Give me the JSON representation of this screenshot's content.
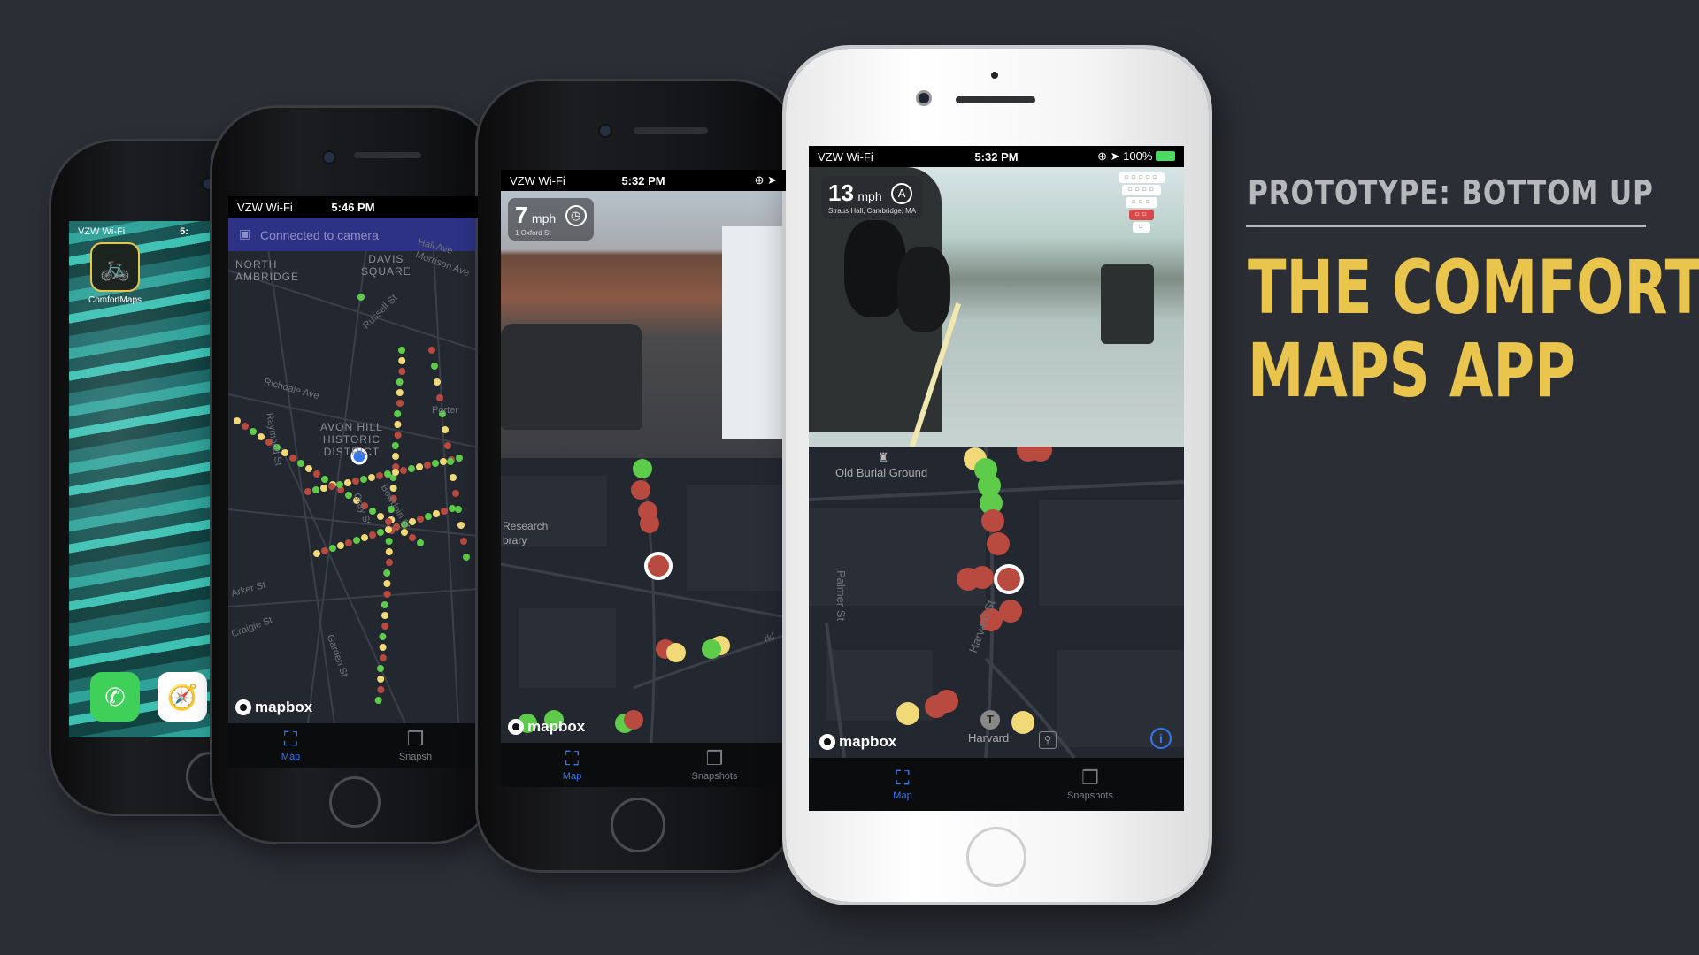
{
  "slide": {
    "kicker": "PROTOTYPE: BOTTOM UP",
    "headline_line1": "THE COMFORT",
    "headline_line2": "MAPS APP"
  },
  "phone1": {
    "status": {
      "carrier": "VZW Wi-Fi",
      "time": "5:"
    },
    "app_label": "ComfortMaps",
    "dock": [
      "phone-icon",
      "safari-icon"
    ]
  },
  "phone2": {
    "status": {
      "carrier": "VZW Wi-Fi",
      "time": "5:46 PM"
    },
    "banner": "Connected to camera",
    "areas": {
      "north_cambridge": "NORTH\nAMBRIDGE",
      "davis": "DAVIS\nSQUARE",
      "avon_hill": "AVON HILL\nHISTORIC\nDISTRICT"
    },
    "streets": [
      "Hall Ave",
      "Morrison Ave",
      "Russell St",
      "Richdale Ave",
      "Raymond St",
      "Porter",
      "Gray St",
      "Bowdoin St",
      "Arker St",
      "Craigie St",
      "Garden St"
    ],
    "mapbox": "mapbox",
    "tabs": [
      {
        "label": "Map",
        "icon": "map-icon"
      },
      {
        "label": "Snapsh",
        "icon": "snapshots-icon"
      }
    ]
  },
  "phone3": {
    "status": {
      "carrier": "VZW Wi-Fi",
      "time": "5:32 PM"
    },
    "speed": {
      "value": "7",
      "unit": "mph",
      "location": "1 Oxford St"
    },
    "places": [
      "Research",
      "brary"
    ],
    "streets": [
      "rkl"
    ],
    "mapbox": "mapbox",
    "tabs": [
      {
        "label": "Map",
        "icon": "map-icon"
      },
      {
        "label": "Snapshots",
        "icon": "snapshots-icon"
      }
    ]
  },
  "phone4": {
    "status": {
      "carrier": "VZW Wi-Fi",
      "time": "5:32 PM",
      "battery": "100%"
    },
    "speed": {
      "value": "13",
      "unit": "mph",
      "compass": "A",
      "location": "Straus Hall, Cambridge, MA"
    },
    "comfort_meter": {
      "levels": 5,
      "active_level": 4
    },
    "places": [
      "Old Burial Ground",
      "Harvard"
    ],
    "streets": [
      "Palmer St",
      "Harvard St"
    ],
    "mapbox": "mapbox",
    "tabs": [
      {
        "label": "Map",
        "icon": "map-icon"
      },
      {
        "label": "Snapshots",
        "icon": "snapshots-icon"
      }
    ]
  },
  "colors": {
    "accent": "#e9c54e",
    "comfort_green": "#5ecb4a",
    "comfort_yellow": "#f2d978",
    "comfort_red": "#b84a3f",
    "tab_active": "#3478f6"
  }
}
